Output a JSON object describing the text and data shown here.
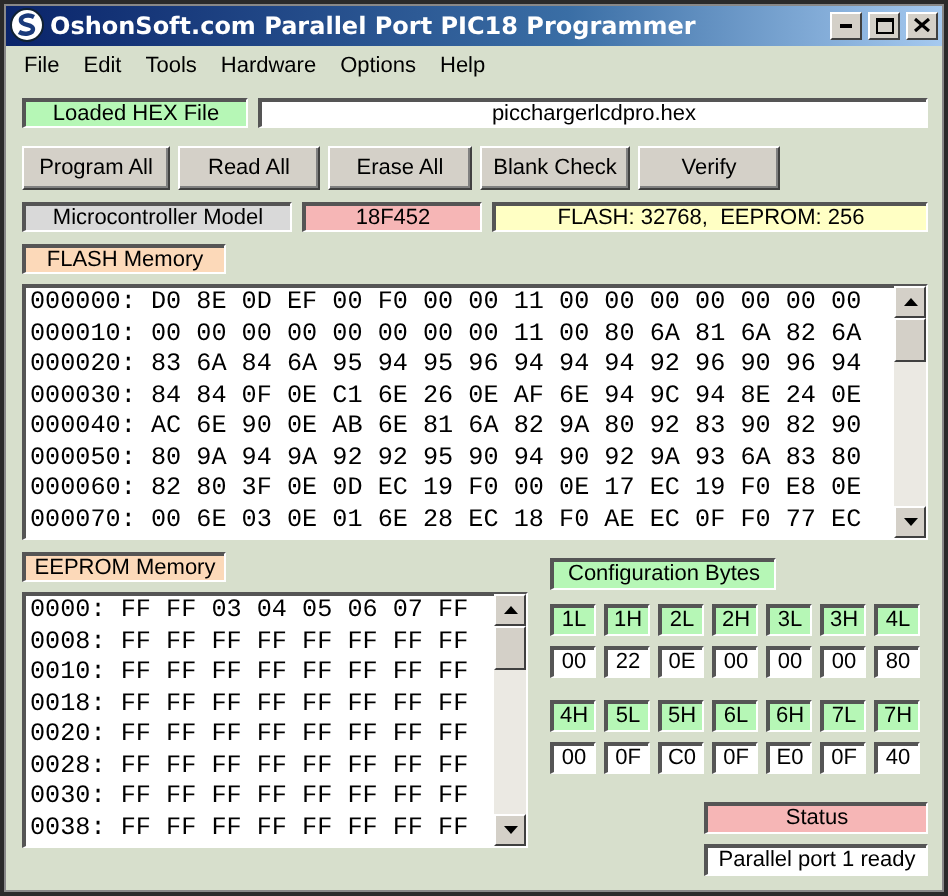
{
  "window": {
    "title": "OshonSoft.com Parallel Port PIC18 Programmer"
  },
  "menu": [
    "File",
    "Edit",
    "Tools",
    "Hardware",
    "Options",
    "Help"
  ],
  "hex_file": {
    "label": "Loaded HEX File",
    "value": "picchargerlcdpro.hex"
  },
  "buttons": [
    "Program All",
    "Read All",
    "Erase All",
    "Blank Check",
    "Verify"
  ],
  "model": {
    "label": "Microcontroller Model",
    "value": "18F452",
    "info": "FLASH: 32768,  EEPROM: 256"
  },
  "flash": {
    "label": "FLASH Memory",
    "rows": [
      "000000: D0 8E 0D EF 00 F0 00 00 11 00 00 00 00 00 00 00",
      "000010: 00 00 00 00 00 00 00 00 11 00 80 6A 81 6A 82 6A",
      "000020: 83 6A 84 6A 95 94 95 96 94 94 94 92 96 90 96 94",
      "000030: 84 84 0F 0E C1 6E 26 0E AF 6E 94 9C 94 8E 24 0E",
      "000040: AC 6E 90 0E AB 6E 81 6A 82 9A 80 92 83 90 82 90",
      "000050: 80 9A 94 9A 92 92 95 90 94 90 92 9A 93 6A 83 80",
      "000060: 82 80 3F 0E 0D EC 19 F0 00 0E 17 EC 19 F0 E8 0E",
      "000070: 00 6E 03 0E 01 6E 28 EC 18 F0 AE EC 0F F0 77 EC"
    ]
  },
  "eeprom": {
    "label": "EEPROM Memory",
    "rows": [
      "0000: FF FF 03 04 05 06 07 FF",
      "0008: FF FF FF FF FF FF FF FF",
      "0010: FF FF FF FF FF FF FF FF",
      "0018: FF FF FF FF FF FF FF FF",
      "0020: FF FF FF FF FF FF FF FF",
      "0028: FF FF FF FF FF FF FF FF",
      "0030: FF FF FF FF FF FF FF FF",
      "0038: FF FF FF FF FF FF FF FF"
    ]
  },
  "config": {
    "title": "Configuration Bytes",
    "bytes": [
      {
        "name": "1L",
        "value": "00"
      },
      {
        "name": "1H",
        "value": "22"
      },
      {
        "name": "2L",
        "value": "0E"
      },
      {
        "name": "2H",
        "value": "00"
      },
      {
        "name": "3L",
        "value": "00"
      },
      {
        "name": "3H",
        "value": "00"
      },
      {
        "name": "4L",
        "value": "80"
      },
      {
        "name": "4H",
        "value": "00"
      },
      {
        "name": "5L",
        "value": "0F"
      },
      {
        "name": "5H",
        "value": "C0"
      },
      {
        "name": "6L",
        "value": "0F"
      },
      {
        "name": "6H",
        "value": "E0"
      },
      {
        "name": "7L",
        "value": "0F"
      },
      {
        "name": "7H",
        "value": "40"
      }
    ]
  },
  "status": {
    "label": "Status",
    "text": "Parallel port 1 ready"
  }
}
